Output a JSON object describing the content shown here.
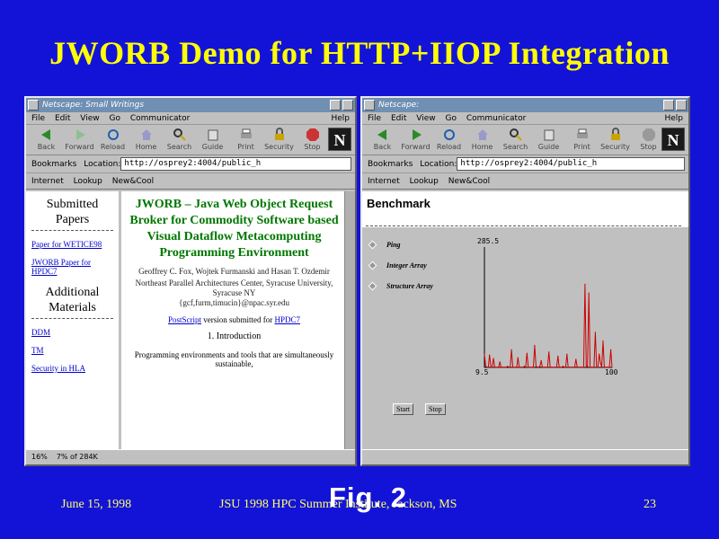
{
  "slide": {
    "title": "JWORB Demo for HTTP+IIOP Integration",
    "footer_date": "June 15, 1998",
    "footer_event": "JSU 1998 HPC Summer Institute, Jackson, MS",
    "page_number": "23",
    "figure_label": "Fig. 2",
    "colors": {
      "background": "#1313d8",
      "title": "#ffff00"
    }
  },
  "left_window": {
    "title": "Netscape: Small Writings",
    "menu": [
      "File",
      "Edit",
      "View",
      "Go",
      "Communicator"
    ],
    "help": "Help",
    "toolbar": [
      {
        "label": "Back",
        "icon": "back-icon"
      },
      {
        "label": "Forward",
        "icon": "forward-icon"
      },
      {
        "label": "Reload",
        "icon": "reload-icon"
      },
      {
        "label": "Home",
        "icon": "home-icon"
      },
      {
        "label": "Search",
        "icon": "search-icon"
      },
      {
        "label": "Guide",
        "icon": "guide-icon"
      },
      {
        "label": "Print",
        "icon": "print-icon"
      },
      {
        "label": "Security",
        "icon": "security-icon"
      },
      {
        "label": "Stop",
        "icon": "stop-icon"
      }
    ],
    "bookmarks": "Bookmarks",
    "location_label": "Location:",
    "url": "http://osprey2:4004/public_h",
    "quicklinks": [
      "Internet",
      "Lookup",
      "New&Cool"
    ],
    "sidebar": {
      "heading1": "Submitted Papers",
      "links1": [
        "Paper for WETICE98",
        "JWORB Paper for HPDC7"
      ],
      "heading2": "Additional Materials",
      "links2": [
        "DDM",
        "TM",
        "Security in HLA"
      ]
    },
    "doc": {
      "title": "JWORB – Java Web Object Request Broker for Commodity Software based Visual Dataflow Metacomputing Programming Environment",
      "authors": "Geoffrey C. Fox, Wojtek Furmanski and Hasan T. Ozdemir",
      "affiliation": "Northeast Parallel Architectures Center, Syracuse University, Syracuse NY",
      "emails": "{gcf,furm,timucin}@npac.syr.edu",
      "ps_link": "PostScript",
      "ps_text_mid": " version submitted for ",
      "ps_target": "HPDC7",
      "section": "1. Introduction",
      "para": "Programming environments and tools that are simultaneously sustainable,"
    },
    "status": [
      "16%",
      "7% of 284K"
    ]
  },
  "right_window": {
    "title": "Netscape:",
    "menu": [
      "File",
      "Edit",
      "View",
      "Go",
      "Communicator"
    ],
    "help": "Help",
    "toolbar": [
      {
        "label": "Back",
        "icon": "back-icon"
      },
      {
        "label": "Forward",
        "icon": "forward-icon"
      },
      {
        "label": "Reload",
        "icon": "reload-icon"
      },
      {
        "label": "Home",
        "icon": "home-icon"
      },
      {
        "label": "Search",
        "icon": "search-icon"
      },
      {
        "label": "Guide",
        "icon": "guide-icon"
      },
      {
        "label": "Print",
        "icon": "print-icon"
      },
      {
        "label": "Security",
        "icon": "security-icon"
      },
      {
        "label": "Stop",
        "icon": "stop-icon"
      }
    ],
    "bookmarks": "Bookmarks",
    "location_label": "Location:",
    "url": "http://osprey2:4004/public_h",
    "quicklinks": [
      "Internet",
      "Lookup",
      "New&Cool"
    ],
    "heading": "Benchmark",
    "options": [
      "Ping",
      "Integer Array",
      "Structure Array"
    ],
    "start_label": "Start",
    "stop_label": "Stop"
  },
  "chart_data": {
    "type": "line",
    "title": "",
    "xlabel": "",
    "ylabel": "",
    "y_top_label": "285.5",
    "y_bottom_label": "9.5",
    "x_right_label": "100",
    "ylim": [
      9.5,
      285.5
    ],
    "xlim": [
      0,
      100
    ],
    "series": [
      {
        "color": "#cc0000",
        "values": [
          40,
          12,
          10,
          10,
          38,
          10,
          10,
          30,
          10,
          10,
          10,
          10,
          22,
          10,
          10,
          10,
          10,
          10,
          12,
          10,
          10,
          50,
          10,
          10,
          10,
          10,
          32,
          10,
          10,
          10,
          10,
          12,
          10,
          42,
          10,
          10,
          10,
          10,
          10,
          60,
          12,
          10,
          10,
          12,
          25,
          10,
          10,
          10,
          10,
          10,
          45,
          10,
          10,
          10,
          10,
          10,
          10,
          35,
          10,
          10,
          10,
          12,
          10,
          10,
          40,
          10,
          10,
          10,
          10,
          10,
          10,
          28,
          10,
          10,
          10,
          10,
          10,
          10,
          200,
          10,
          12,
          180,
          10,
          10,
          10,
          10,
          90,
          10,
          10,
          40,
          20,
          10,
          70,
          10,
          10,
          10,
          10,
          10,
          50,
          10
        ]
      }
    ]
  }
}
